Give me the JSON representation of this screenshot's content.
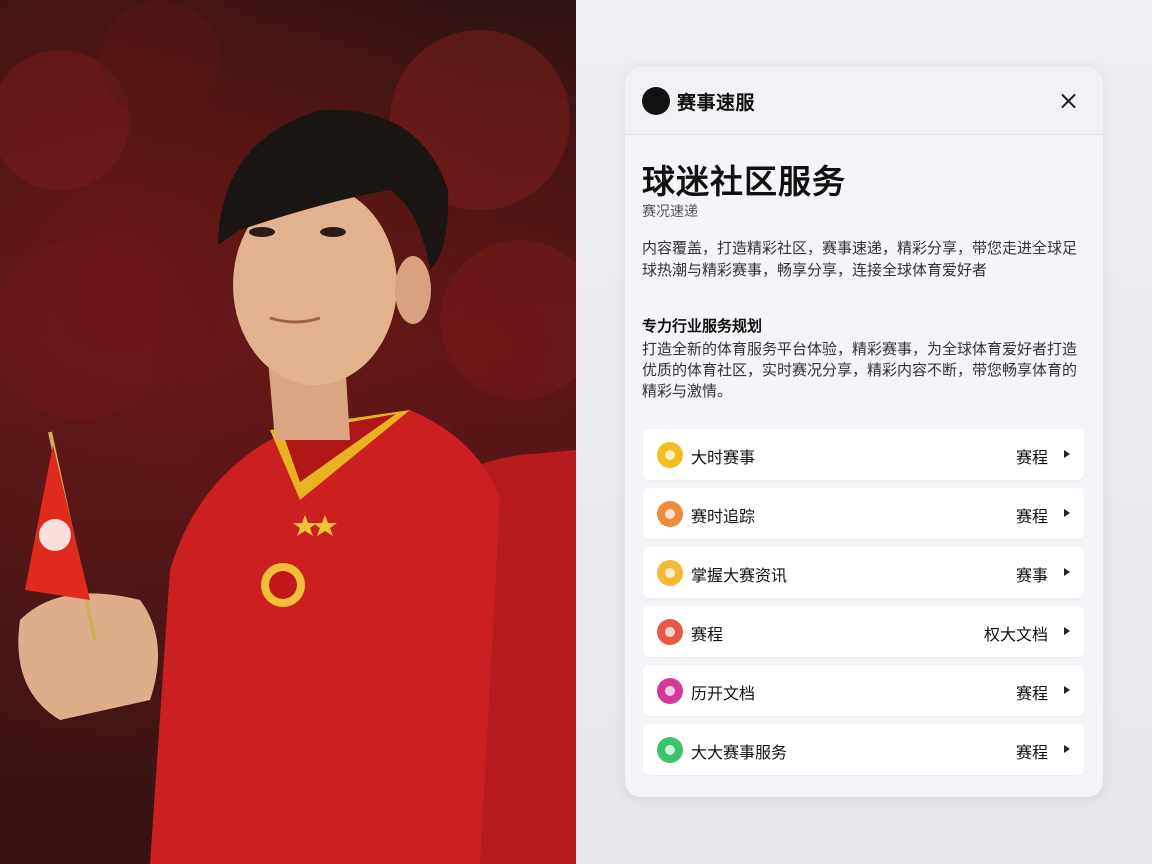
{
  "header": {
    "brand": "赛事速服",
    "logo_icon": "ball-logo-icon",
    "close_icon": "close-icon"
  },
  "main": {
    "title": "球迷社区服务",
    "subtitle": "赛况速递",
    "intro": "内容覆盖，打造精彩社区，赛事速递，精彩分享，带您走进全球足球热潮与精彩赛事，畅享分享，连接全球体育爱好者",
    "section_heading": "专力行业服务规划",
    "section_body": "打造全新的体育服务平台体验，精彩赛事，为全球体育爱好者打造优质的体育社区，实时赛况分享，精彩内容不断，带您畅享体育的精彩与激情。"
  },
  "services": [
    {
      "label": "大时赛事",
      "action": "赛程",
      "icon": "trophy-icon",
      "color": "#f2c01e"
    },
    {
      "label": "赛时追踪",
      "action": "赛程",
      "icon": "ball-icon",
      "color": "#f08a3c"
    },
    {
      "label": "掌握大赛资讯",
      "action": "赛事",
      "icon": "news-icon",
      "color": "#f5b935"
    },
    {
      "label": "赛程",
      "action": "权大文档",
      "icon": "calendar-icon",
      "color": "#e65a4a"
    },
    {
      "label": "历开文档",
      "action": "赛程",
      "icon": "document-icon",
      "color": "#d43a9a"
    },
    {
      "label": "大大赛事服务",
      "action": "赛程",
      "icon": "service-icon",
      "color": "#3cc46a"
    }
  ]
}
